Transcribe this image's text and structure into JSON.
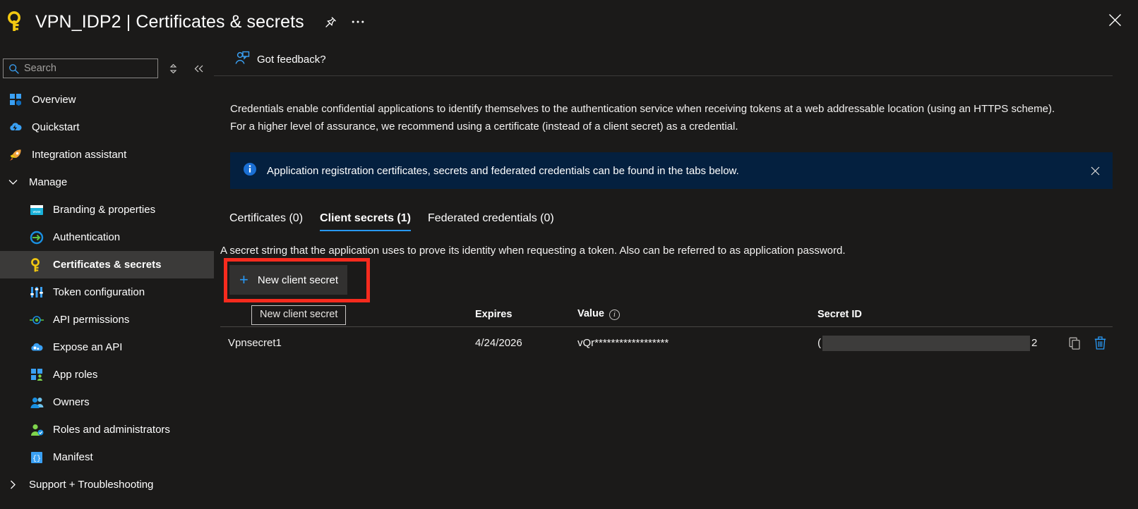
{
  "titlebar": {
    "app_icon": "key-icon",
    "resource_name": "VPN_IDP2",
    "separator": "|",
    "page_section": "Certificates & secrets",
    "full_title": "VPN_IDP2 | Certificates & secrets",
    "pin_icon": "pin-icon",
    "more_icon": "ellipsis-icon",
    "close_icon": "close-icon"
  },
  "sidebar": {
    "search": {
      "placeholder": "Search",
      "value": "",
      "icon": "search-icon"
    },
    "expand_icon": "expand-collapse-icon",
    "collapse_icon": "double-chevron-left-icon",
    "items": [
      {
        "label": "Overview",
        "icon": "grid-cube-icon",
        "level": "top",
        "selected": false
      },
      {
        "label": "Quickstart",
        "icon": "cloud-lightning-icon",
        "level": "top",
        "selected": false
      },
      {
        "label": "Integration assistant",
        "icon": "rocket-icon",
        "level": "top",
        "selected": false
      },
      {
        "label": "Manage",
        "icon": "chevron-down-icon",
        "level": "group",
        "selected": false
      },
      {
        "label": "Branding & properties",
        "icon": "browser-window-icon",
        "level": "sub",
        "selected": false
      },
      {
        "label": "Authentication",
        "icon": "arrow-circle-icon",
        "level": "sub",
        "selected": false
      },
      {
        "label": "Certificates & secrets",
        "icon": "key-icon",
        "level": "sub",
        "selected": true
      },
      {
        "label": "Token configuration",
        "icon": "sliders-icon",
        "level": "sub",
        "selected": false
      },
      {
        "label": "API permissions",
        "icon": "plug-connector-icon",
        "level": "sub",
        "selected": false
      },
      {
        "label": "Expose an API",
        "icon": "cloud-gear-icon",
        "level": "sub",
        "selected": false
      },
      {
        "label": "App roles",
        "icon": "grid-person-icon",
        "level": "sub",
        "selected": false
      },
      {
        "label": "Owners",
        "icon": "people-icon",
        "level": "sub",
        "selected": false
      },
      {
        "label": "Roles and administrators",
        "icon": "person-badge-icon",
        "level": "sub",
        "selected": false
      },
      {
        "label": "Manifest",
        "icon": "braces-document-icon",
        "level": "sub",
        "selected": false
      },
      {
        "label": "Support + Troubleshooting",
        "icon": "chevron-right-icon",
        "level": "group",
        "selected": false
      }
    ]
  },
  "commandbar": {
    "feedback_label": "Got feedback?",
    "feedback_icon": "feedback-person-icon"
  },
  "content": {
    "description": "Credentials enable confidential applications to identify themselves to the authentication service when receiving tokens at a web addressable location (using an HTTPS scheme). For a higher level of assurance, we recommend using a certificate (instead of a client secret) as a credential.",
    "infobar": {
      "icon": "info-circle-icon",
      "text": "Application registration certificates, secrets and federated credentials can be found in the tabs below.",
      "close_icon": "close-icon",
      "background": "#04203f"
    },
    "tabs": [
      {
        "label": "Certificates (0)",
        "active": false
      },
      {
        "label": "Client secrets (1)",
        "active": true
      },
      {
        "label": "Federated credentials (0)",
        "active": false
      }
    ],
    "tab_accent": "#2899f5",
    "subdescription": "A secret string that the application uses to prove its identity when requesting a token. Also can be referred to as application password.",
    "new_secret_button": {
      "label": "New client secret",
      "plus_icon": "plus-icon",
      "tooltip": "New client secret",
      "highlight_color": "#f62b1e"
    },
    "table": {
      "headers": {
        "description": "",
        "expires": "Expires",
        "value": "Value",
        "value_info_icon": "info-icon",
        "secret_id": "Secret ID"
      },
      "rows": [
        {
          "description": "Vpnsecret1",
          "expires": "4/24/2026",
          "value": "vQr******************",
          "secret_id_prefix": "(",
          "secret_id_redacted": true,
          "secret_id_suffix": "2",
          "copy_icon": "copy-icon",
          "delete_icon": "trash-icon"
        }
      ]
    }
  }
}
